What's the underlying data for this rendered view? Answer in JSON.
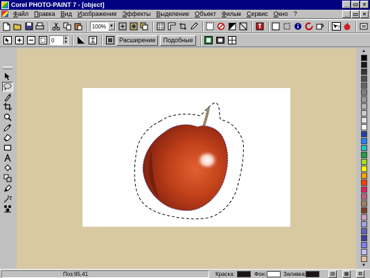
{
  "window": {
    "title": "Corel PHOTO-PAINT 7 - [object]",
    "minimize_glyph": "_",
    "restore_glyph": "▭",
    "close_glyph": "×"
  },
  "menu": {
    "items": [
      "Файл",
      "Правка",
      "Вид",
      "Изображение",
      "Эффекты",
      "Выделение",
      "Объект",
      "Фильм",
      "Сервис",
      "Окно",
      "?"
    ]
  },
  "toolbar1": {
    "zoom_value": "100%",
    "combo_arrow": "▼"
  },
  "toolbar2": {
    "number_value": "0",
    "expand_label": "Расширение",
    "similar_label": "Подобные"
  },
  "status": {
    "position": "Поз:95,41",
    "paint_label": "Краска:",
    "paper_label": "Фон:",
    "fill_label": "Заливка:"
  },
  "colors": {
    "workspace_bg": "#d9c9a3",
    "title_bar": "#000080",
    "paint_color": "#1a1418",
    "paper_color": "#ffffff",
    "fill_color": "#1a1418",
    "palette": [
      "#000000",
      "#1a1a1a",
      "#333333",
      "#4d4d4d",
      "#666666",
      "#808080",
      "#999999",
      "#b3b3b3",
      "#cccccc",
      "#e6e6e6",
      "#ffffff",
      "#2040a0",
      "#2080ff",
      "#20c0c0",
      "#20a040",
      "#a0e020",
      "#ffff00",
      "#ffa000",
      "#ff4000",
      "#e02060",
      "#c06080",
      "#a08060",
      "#804020",
      "#d0a0c0",
      "#a0a0e0",
      "#6060c0",
      "#4040a0",
      "#8080ff",
      "#c0c0ff",
      "#e0c0a0"
    ]
  }
}
